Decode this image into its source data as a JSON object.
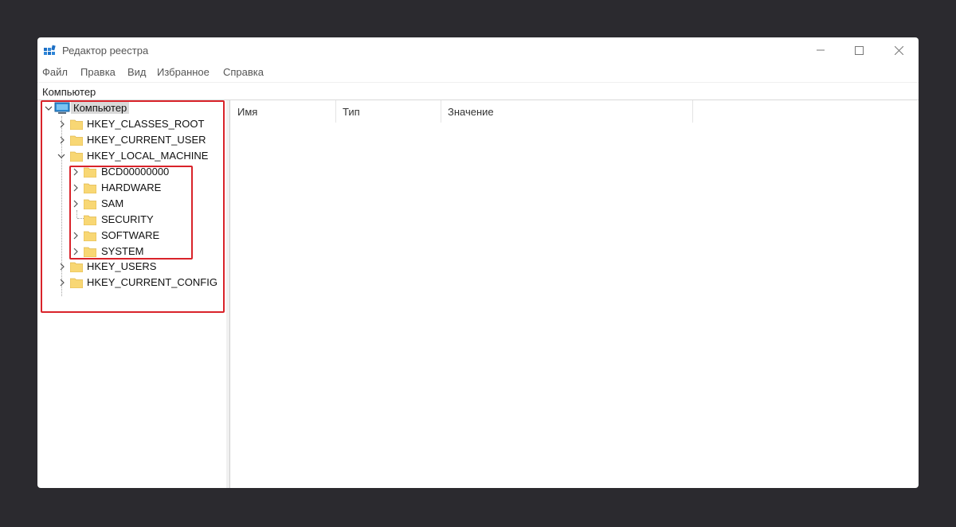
{
  "window": {
    "title": "Редактор реестра",
    "accent_color": "#4a90d9",
    "highlight_color": "#d9232a"
  },
  "menu": [
    "Файл",
    "Правка",
    "Вид",
    "Избранное",
    "Справка"
  ],
  "address": "Компьютер",
  "tree": {
    "root": "Компьютер",
    "hives": [
      "HKEY_CLASSES_ROOT",
      "HKEY_CURRENT_USER",
      "HKEY_LOCAL_MACHINE",
      "HKEY_USERS",
      "HKEY_CURRENT_CONFIG"
    ],
    "hklm_children": [
      "BCD00000000",
      "HARDWARE",
      "SAM",
      "SECURITY",
      "SOFTWARE",
      "SYSTEM"
    ]
  },
  "columns": [
    "Имя",
    "Тип",
    "Значение"
  ]
}
